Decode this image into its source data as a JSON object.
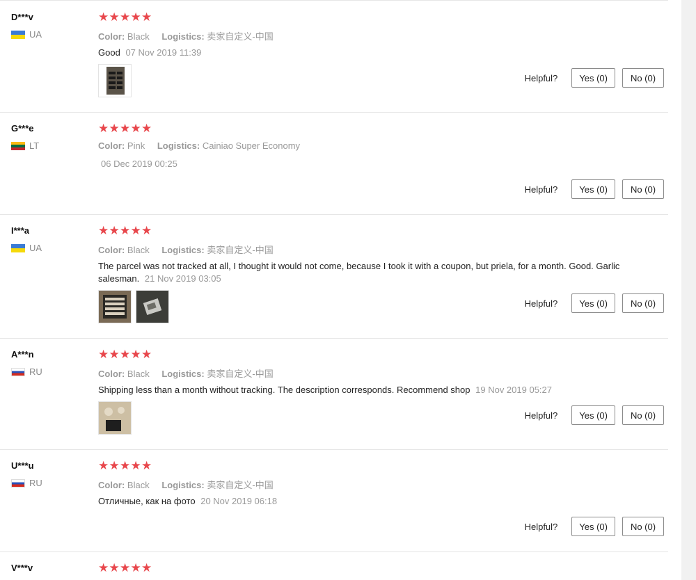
{
  "labels": {
    "color": "Color:",
    "logistics": "Logistics:",
    "helpful": "Helpful?"
  },
  "star_glyph": "★",
  "star_color": "#e8474c",
  "reviews": [
    {
      "user": "D***v",
      "country": "UA",
      "flag": "ua",
      "rating": 5,
      "color": "Black",
      "logistics": "卖家自定义-中国",
      "text": "Good",
      "date": "07 Nov 2019 11:39",
      "photos": 1,
      "yes": "Yes (0)",
      "no": "No (0)"
    },
    {
      "user": "G***e",
      "country": "LT",
      "flag": "lt",
      "rating": 5,
      "color": "Pink",
      "logistics": "Cainiao Super Economy",
      "text": "",
      "date": "06 Dec 2019 00:25",
      "photos": 0,
      "yes": "Yes (0)",
      "no": "No (0)"
    },
    {
      "user": "I***a",
      "country": "UA",
      "flag": "ua",
      "rating": 5,
      "color": "Black",
      "logistics": "卖家自定义-中国",
      "text": "The parcel was not tracked at all, I thought it would not come, because I took it with a coupon, but priela, for a month. Good. Garlic salesman.",
      "date": "21 Nov 2019 03:05",
      "photos": 2,
      "yes": "Yes (0)",
      "no": "No (0)"
    },
    {
      "user": "A***n",
      "country": "RU",
      "flag": "ru",
      "rating": 5,
      "color": "Black",
      "logistics": "卖家自定义-中国",
      "text": "Shipping less than a month without tracking. The description corresponds. Recommend shop",
      "date": "19 Nov 2019 05:27",
      "photos": 1,
      "yes": "Yes (0)",
      "no": "No (0)"
    },
    {
      "user": "U***u",
      "country": "RU",
      "flag": "ru",
      "rating": 5,
      "color": "Black",
      "logistics": "卖家自定义-中国",
      "text": "Отличные, как на фото",
      "date": "20 Nov 2019 06:18",
      "photos": 0,
      "yes": "Yes (0)",
      "no": "No (0)"
    },
    {
      "user": "V***v",
      "rating": 5
    }
  ]
}
